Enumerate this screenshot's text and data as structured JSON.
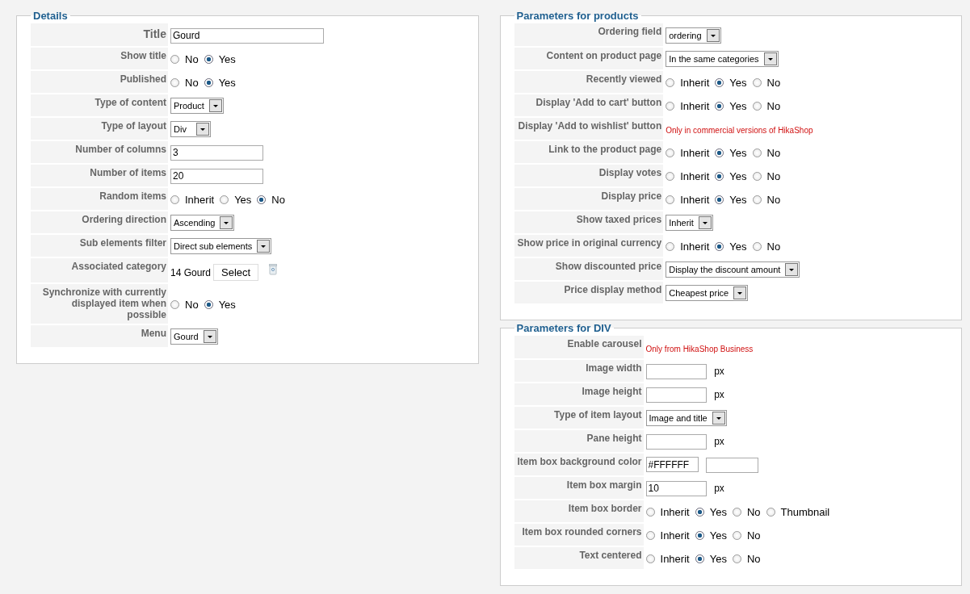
{
  "columns": [
    {
      "panels": [
        {
          "title": "Details",
          "rows": [
            {
              "kind": "title",
              "label": "Title",
              "value": "Gourd"
            },
            {
              "kind": "radio",
              "label": "Show title",
              "options": [
                {
                  "label": "No",
                  "selected": false
                },
                {
                  "label": "Yes",
                  "selected": true
                }
              ]
            },
            {
              "kind": "radio",
              "label": "Published",
              "options": [
                {
                  "label": "No",
                  "selected": false
                },
                {
                  "label": "Yes",
                  "selected": true
                }
              ]
            },
            {
              "kind": "select",
              "label": "Type of content",
              "value": "Product"
            },
            {
              "kind": "select",
              "label": "Type of layout",
              "value": "Div"
            },
            {
              "kind": "text",
              "label": "Number of columns",
              "value": "3"
            },
            {
              "kind": "text",
              "label": "Number of items",
              "value": "20"
            },
            {
              "kind": "radio",
              "label": "Random items",
              "options": [
                {
                  "label": "Inherit",
                  "selected": false
                },
                {
                  "label": "Yes",
                  "selected": false
                },
                {
                  "label": "No",
                  "selected": true
                }
              ]
            },
            {
              "kind": "select",
              "label": "Ordering direction",
              "value": "Ascending"
            },
            {
              "kind": "select",
              "label": "Sub elements filter",
              "value": "Direct sub elements"
            },
            {
              "kind": "category",
              "label": "Associated category",
              "value": "14 Gourd",
              "button": "Select"
            },
            {
              "kind": "radio",
              "label": "Synchronize with currently displayed item when possible",
              "options": [
                {
                  "label": "No",
                  "selected": false
                },
                {
                  "label": "Yes",
                  "selected": true
                }
              ]
            },
            {
              "kind": "select",
              "label": "Menu",
              "value": "Gourd"
            }
          ]
        }
      ]
    },
    {
      "panels": [
        {
          "title": "Parameters for products",
          "rows": [
            {
              "kind": "select",
              "label": "Ordering field",
              "value": "ordering"
            },
            {
              "kind": "select",
              "label": "Content on product page",
              "value": "In the same categories"
            },
            {
              "kind": "radio",
              "label": "Recently viewed",
              "options": [
                {
                  "label": "Inherit",
                  "selected": false
                },
                {
                  "label": "Yes",
                  "selected": true
                },
                {
                  "label": "No",
                  "selected": false
                }
              ]
            },
            {
              "kind": "radio",
              "label": "Display 'Add to cart' button",
              "options": [
                {
                  "label": "Inherit",
                  "selected": false
                },
                {
                  "label": "Yes",
                  "selected": true
                },
                {
                  "label": "No",
                  "selected": false
                }
              ]
            },
            {
              "kind": "notice",
              "label": "Display 'Add to wishlist' button",
              "text": "Only in commercial versions of HikaShop"
            },
            {
              "kind": "radio",
              "label": "Link to the product page",
              "options": [
                {
                  "label": "Inherit",
                  "selected": false
                },
                {
                  "label": "Yes",
                  "selected": true
                },
                {
                  "label": "No",
                  "selected": false
                }
              ]
            },
            {
              "kind": "radio",
              "label": "Display votes",
              "options": [
                {
                  "label": "Inherit",
                  "selected": false
                },
                {
                  "label": "Yes",
                  "selected": true
                },
                {
                  "label": "No",
                  "selected": false
                }
              ]
            },
            {
              "kind": "radio",
              "label": "Display price",
              "options": [
                {
                  "label": "Inherit",
                  "selected": false
                },
                {
                  "label": "Yes",
                  "selected": true
                },
                {
                  "label": "No",
                  "selected": false
                }
              ]
            },
            {
              "kind": "select",
              "label": "Show taxed prices",
              "value": "Inherit"
            },
            {
              "kind": "radio",
              "label": "Show price in original currency",
              "options": [
                {
                  "label": "Inherit",
                  "selected": false
                },
                {
                  "label": "Yes",
                  "selected": true
                },
                {
                  "label": "No",
                  "selected": false
                }
              ]
            },
            {
              "kind": "select",
              "label": "Show discounted price",
              "value": "Display the discount amount"
            },
            {
              "kind": "select",
              "label": "Price display method",
              "value": "Cheapest price"
            }
          ]
        },
        {
          "title": "Parameters for DIV",
          "rows": [
            {
              "kind": "notice",
              "label": "Enable carousel",
              "text": "Only from HikaShop Business"
            },
            {
              "kind": "text_px",
              "label": "Image width",
              "unit": "px"
            },
            {
              "kind": "text_px",
              "label": "Image height",
              "unit": "px"
            },
            {
              "kind": "select",
              "label": "Type of item layout",
              "value": "Image and title"
            },
            {
              "kind": "text_px",
              "label": "Pane height",
              "unit": "px"
            },
            {
              "kind": "color",
              "label": "Item box background color",
              "value": "#FFFFFF"
            },
            {
              "kind": "text_px",
              "label": "Item box margin",
              "value": "10",
              "unit": "px"
            },
            {
              "kind": "radio",
              "label": "Item box border",
              "options": [
                {
                  "label": "Inherit",
                  "selected": false
                },
                {
                  "label": "Yes",
                  "selected": true
                },
                {
                  "label": "No",
                  "selected": false
                },
                {
                  "label": "Thumbnail",
                  "selected": false
                }
              ]
            },
            {
              "kind": "radio",
              "label": "Item box rounded corners",
              "options": [
                {
                  "label": "Inherit",
                  "selected": false
                },
                {
                  "label": "Yes",
                  "selected": true
                },
                {
                  "label": "No",
                  "selected": false
                }
              ]
            },
            {
              "kind": "radio",
              "label": "Text centered",
              "options": [
                {
                  "label": "Inherit",
                  "selected": false
                },
                {
                  "label": "Yes",
                  "selected": true
                },
                {
                  "label": "No",
                  "selected": false
                }
              ]
            }
          ]
        }
      ]
    }
  ]
}
